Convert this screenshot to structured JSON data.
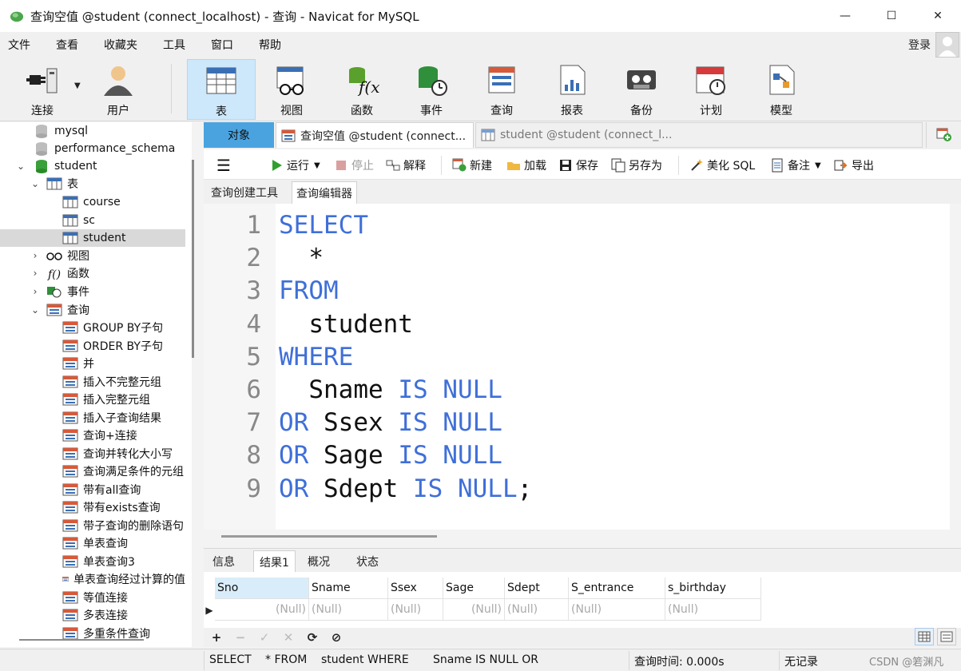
{
  "window": {
    "title": "查询空值 @student (connect_localhost) - 查询 - Navicat for MySQL",
    "minimize_glyph": "—",
    "maximize_glyph": "☐",
    "close_glyph": "✕"
  },
  "menu": {
    "items": [
      "文件",
      "查看",
      "收藏夹",
      "工具",
      "窗口",
      "帮助"
    ],
    "login": "登录"
  },
  "toolbar": {
    "items": [
      {
        "label": "连接",
        "icon": "plug-icon"
      },
      {
        "label": "用户",
        "icon": "user-icon"
      },
      {
        "label": "表",
        "icon": "table-icon",
        "active": true
      },
      {
        "label": "视图",
        "icon": "view-icon"
      },
      {
        "label": "函数",
        "icon": "function-icon"
      },
      {
        "label": "事件",
        "icon": "event-icon"
      },
      {
        "label": "查询",
        "icon": "query-icon"
      },
      {
        "label": "报表",
        "icon": "report-icon"
      },
      {
        "label": "备份",
        "icon": "backup-icon"
      },
      {
        "label": "计划",
        "icon": "schedule-icon"
      },
      {
        "label": "模型",
        "icon": "model-icon"
      }
    ]
  },
  "tree": {
    "databases": [
      "mysql",
      "performance_schema",
      "student"
    ],
    "tables_group": "表",
    "tables": [
      "course",
      "sc",
      "student"
    ],
    "groups": [
      "视图",
      "函数",
      "事件",
      "查询"
    ],
    "queries": [
      "GROUP BY子句",
      "ORDER BY子句",
      "并",
      "插入不完整元组",
      "插入完整元组",
      "插入子查询结果",
      "查询+连接",
      "查询并转化大小写",
      "查询满足条件的元组",
      "带有all查询",
      "带有exists查询",
      "带子查询的删除语句",
      "单表查询",
      "单表查询3",
      "单表查询经过计算的值",
      "等值连接",
      "多表连接",
      "多重条件查询"
    ]
  },
  "tabs": {
    "objects": "对象",
    "active": "查询空值 @student (connect...",
    "inactive": "student @student (connect_l..."
  },
  "querybar": {
    "run": "运行",
    "stop": "停止",
    "explain": "解释",
    "new": "新建",
    "load": "加载",
    "save": "保存",
    "saveas": "另存为",
    "beautify": "美化 SQL",
    "comment": "备注",
    "export": "导出"
  },
  "subtabs": [
    "查询创建工具",
    "查询编辑器"
  ],
  "editor": {
    "line_numbers": [
      "1",
      "2",
      "3",
      "4",
      "5",
      "6",
      "7",
      "8",
      "9"
    ],
    "lines": [
      [
        {
          "t": "SELECT",
          "k": true
        }
      ],
      [
        {
          "t": "  *",
          "k": false
        }
      ],
      [
        {
          "t": "FROM",
          "k": true
        }
      ],
      [
        {
          "t": "  student",
          "k": false
        }
      ],
      [
        {
          "t": "WHERE",
          "k": true
        }
      ],
      [
        {
          "t": "  Sname ",
          "k": false
        },
        {
          "t": "IS NULL",
          "k": true
        }
      ],
      [
        {
          "t": "OR",
          "k": true
        },
        {
          "t": " Ssex ",
          "k": false
        },
        {
          "t": "IS NULL",
          "k": true
        }
      ],
      [
        {
          "t": "OR",
          "k": true
        },
        {
          "t": " Sage ",
          "k": false
        },
        {
          "t": "IS NULL",
          "k": true
        }
      ],
      [
        {
          "t": "OR",
          "k": true
        },
        {
          "t": " Sdept ",
          "k": false
        },
        {
          "t": "IS NULL",
          "k": true
        },
        {
          "t": ";",
          "k": false
        }
      ]
    ]
  },
  "result_tabs": [
    "信息",
    "结果1",
    "概况",
    "状态"
  ],
  "grid": {
    "columns": [
      "Sno",
      "Sname",
      "Ssex",
      "Sage",
      "Sdept",
      "S_entrance",
      "s_birthday"
    ],
    "row": [
      "(Null)",
      "(Null)",
      "(Null)",
      "(Null)",
      "(Null)",
      "(Null)",
      "(Null)"
    ]
  },
  "gridbar": {
    "add": "+",
    "remove": "−",
    "apply": "✓",
    "discard": "✕",
    "refresh": "⟳",
    "stop": "⊘"
  },
  "status": {
    "sql1": "SELECT",
    "sql2": "* FROM",
    "sql3": "student WHERE",
    "sql4": "Sname IS NULL OR",
    "time": "查询时间: 0.000s",
    "records": "无记录",
    "watermark": "CSDN @箬渊凡"
  },
  "colors": {
    "accent": "#4aa3df",
    "keyword": "#3f6fd8",
    "selected": "#cde8fb"
  }
}
